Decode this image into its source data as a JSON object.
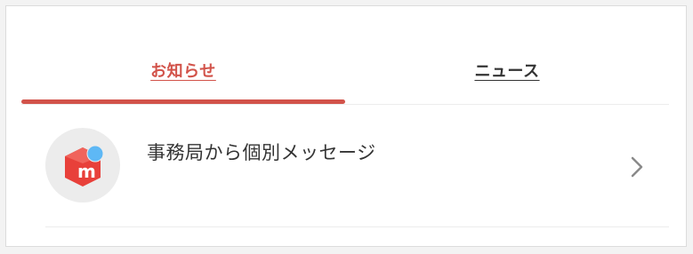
{
  "tabs": [
    {
      "label": "お知らせ",
      "active": true
    },
    {
      "label": "ニュース",
      "active": false
    }
  ],
  "notifications": [
    {
      "title": "事務局から個別メッセージ",
      "icon": "mercari-logo-icon"
    }
  ],
  "colors": {
    "accent": "#d2534a",
    "logo_red": "#e8403a",
    "badge_blue": "#5eb8f5",
    "text": "#333333",
    "chevron": "#8a8a8a"
  }
}
